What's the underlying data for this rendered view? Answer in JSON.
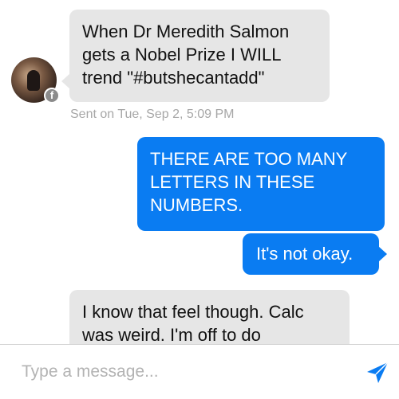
{
  "conversation": {
    "messages": [
      {
        "direction": "incoming",
        "lines": [
          "When Dr Meredith Salmon",
          "gets a Nobel Prize I WILL",
          "trend \"#butshecantadd\""
        ]
      },
      {
        "direction": "outgoing",
        "lines": [
          "THERE ARE TOO MANY",
          "LETTERS IN THESE",
          "NUMBERS."
        ]
      },
      {
        "direction": "outgoing",
        "lines": [
          "It's not okay."
        ]
      },
      {
        "direction": "incoming",
        "lines": [
          "I know that feel though. Calc",
          "was weird. I'm off to do"
        ]
      }
    ],
    "sent_meta": "Sent on Tue, Sep 2, 5:09 PM",
    "avatar_badge": "f"
  },
  "composer": {
    "placeholder": "Type a message...",
    "value": "",
    "send_icon": "paper-plane-icon"
  },
  "colors": {
    "incoming_bubble": "#e6e6e6",
    "outgoing_bubble": "#0a7cf2",
    "meta_text": "#a7a7a7",
    "send_icon": "#0a7cf2"
  }
}
